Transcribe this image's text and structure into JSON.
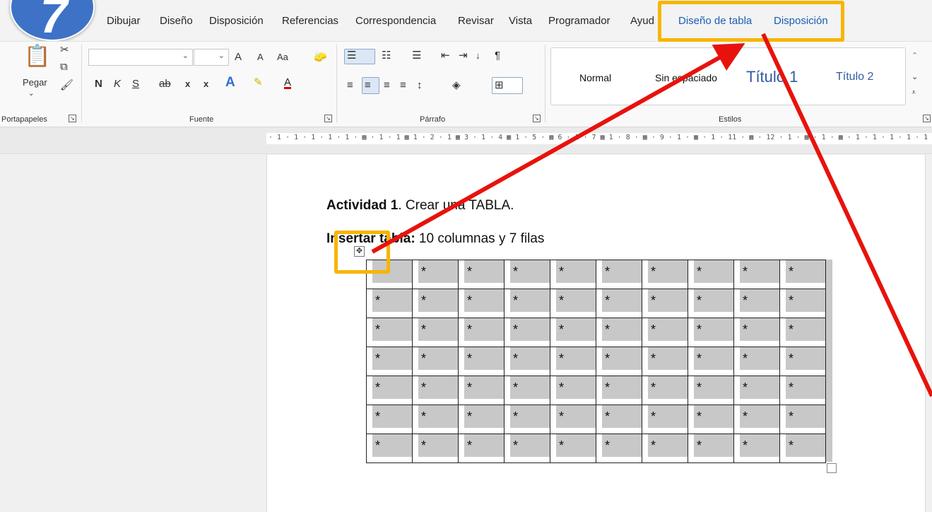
{
  "tutorial": {
    "step_number": "7"
  },
  "menu": {
    "tabs": [
      {
        "id": "dibujar",
        "label": "Dibujar"
      },
      {
        "id": "diseno",
        "label": "Diseño"
      },
      {
        "id": "disposicion",
        "label": "Disposición"
      },
      {
        "id": "referencias",
        "label": "Referencias"
      },
      {
        "id": "correspondencia",
        "label": "Correspondencia"
      },
      {
        "id": "revisar",
        "label": "Revisar"
      },
      {
        "id": "vista",
        "label": "Vista"
      },
      {
        "id": "programador",
        "label": "Programador"
      },
      {
        "id": "ayuda",
        "label": "Ayud"
      }
    ],
    "context_tabs": [
      {
        "id": "diseno-tabla",
        "label": "Diseño de tabla"
      },
      {
        "id": "disposicion-tabla",
        "label": "Disposición"
      }
    ]
  },
  "ribbon": {
    "clipboard": {
      "paste_label": "Pegar",
      "group_label": "Portapapeles"
    },
    "font": {
      "group_label": "Fuente",
      "bold": "N",
      "italic": "K",
      "underline": "S",
      "strike": "ab",
      "subscript": "x",
      "superscript": "x",
      "grow": "A",
      "shrink": "A",
      "case": "Aa",
      "font_color": "A"
    },
    "paragraph": {
      "group_label": "Párrafo"
    },
    "styles": {
      "group_label": "Estilos",
      "items": [
        {
          "id": "normal",
          "label": "Normal"
        },
        {
          "id": "sin-espaciado",
          "label": "Sin espaciado"
        },
        {
          "id": "titulo1",
          "label": "Título 1"
        },
        {
          "id": "titulo2",
          "label": "Título 2"
        }
      ]
    }
  },
  "ruler": {
    "marks": "· 1 · 1 · 1 · 1 · 1 · ▦ · 1 · 1 ▦ 1 · 2 · 1 ▦ 3 · 1 · 4 ▦ 1 · 5 · ▦ 6 · 1 · 7 ▦ 1 · 8 · ▦ · 9 · 1 · ▦ · 1 · 11 · ▦ · 12 · 1 · ▦ · 1 · ▦ · 1 · 1 · 1 · 1 · 1"
  },
  "document": {
    "activity_bold": "Actividad 1",
    "activity_rest": ". Crear una TABLA.",
    "insert_bold": "Insertar tabla:",
    "insert_rest": " 10 columnas y 7 filas",
    "table": {
      "columns": 10,
      "rows": 7,
      "cell_text": "*",
      "first_cell_text": ""
    }
  },
  "colors": {
    "highlight_box": "#f7b500",
    "arrow": "#e8120c",
    "context_tab": "#1a5eb5",
    "badge": "#3d72c7"
  }
}
